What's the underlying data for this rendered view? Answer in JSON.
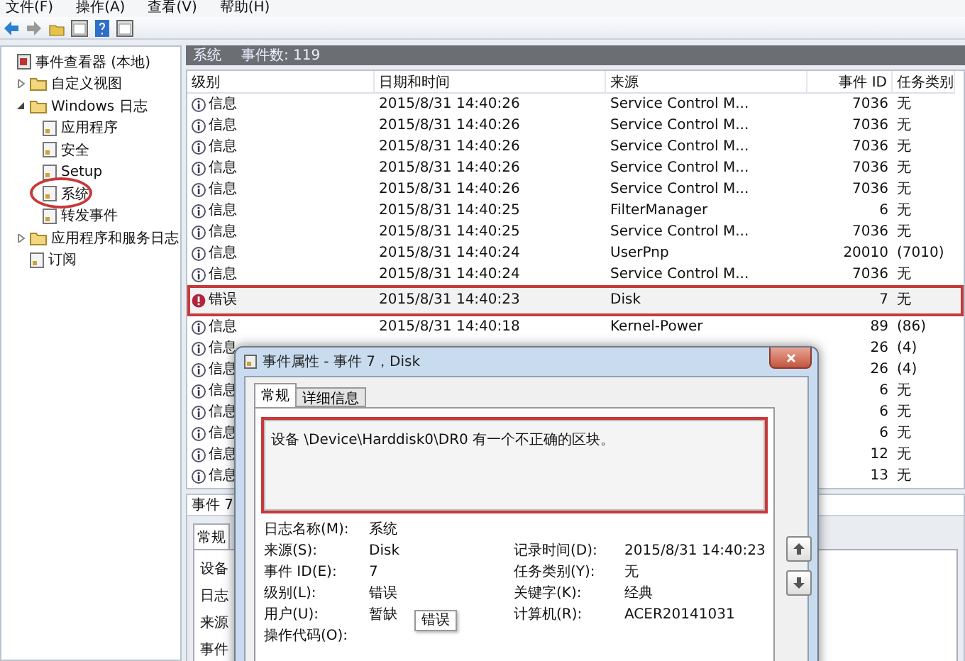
{
  "menu": [
    "文件(F)",
    "操作(A)",
    "查看(V)",
    "帮助(H)"
  ],
  "tree": [
    {
      "label": "事件查看器 (本地)",
      "kind": "root",
      "children": [
        {
          "label": "自定义视图",
          "kind": "folder",
          "expanded": false
        },
        {
          "label": "Windows 日志",
          "kind": "folder",
          "expanded": true,
          "children": [
            {
              "label": "应用程序",
              "kind": "log",
              "circled": false
            },
            {
              "label": "安全",
              "kind": "log",
              "circled": false
            },
            {
              "label": "Setup",
              "kind": "log",
              "circled": false
            },
            {
              "label": "系统",
              "kind": "log",
              "circled": true
            },
            {
              "label": "转发事件",
              "kind": "log",
              "circled": false
            }
          ]
        },
        {
          "label": "应用程序和服务日志",
          "kind": "folder",
          "expanded": false
        },
        {
          "label": "订阅",
          "kind": "log"
        }
      ]
    }
  ],
  "panel": {
    "title": "系统",
    "count": "事件数: 119"
  },
  "table": {
    "columns": [
      "级别",
      "日期和时间",
      "来源",
      "事件 ID",
      "任务类别"
    ],
    "rows": [
      {
        "kind": "info",
        "level": "信息",
        "date": "2015/8/31 14:40:26",
        "source": "Service Control M...",
        "id": "7036",
        "task": "无",
        "highlighted": false
      },
      {
        "kind": "info",
        "level": "信息",
        "date": "2015/8/31 14:40:26",
        "source": "Service Control M...",
        "id": "7036",
        "task": "无",
        "highlighted": false
      },
      {
        "kind": "info",
        "level": "信息",
        "date": "2015/8/31 14:40:26",
        "source": "Service Control M...",
        "id": "7036",
        "task": "无",
        "highlighted": false
      },
      {
        "kind": "info",
        "level": "信息",
        "date": "2015/8/31 14:40:26",
        "source": "Service Control M...",
        "id": "7036",
        "task": "无",
        "highlighted": false
      },
      {
        "kind": "info",
        "level": "信息",
        "date": "2015/8/31 14:40:26",
        "source": "Service Control M...",
        "id": "7036",
        "task": "无",
        "highlighted": false
      },
      {
        "kind": "info",
        "level": "信息",
        "date": "2015/8/31 14:40:25",
        "source": "FilterManager",
        "id": "6",
        "task": "无",
        "highlighted": false
      },
      {
        "kind": "info",
        "level": "信息",
        "date": "2015/8/31 14:40:25",
        "source": "Service Control M...",
        "id": "7036",
        "task": "无",
        "highlighted": false
      },
      {
        "kind": "info",
        "level": "信息",
        "date": "2015/8/31 14:40:24",
        "source": "UserPnp",
        "id": "20010",
        "task": "(7010)",
        "highlighted": false
      },
      {
        "kind": "info",
        "level": "信息",
        "date": "2015/8/31 14:40:24",
        "source": "Service Control M...",
        "id": "7036",
        "task": "无",
        "highlighted": false
      },
      {
        "kind": "error",
        "level": "错误",
        "date": "2015/8/31 14:40:23",
        "source": "Disk",
        "id": "7",
        "task": "无",
        "highlighted": true
      },
      {
        "kind": "info",
        "level": "信息",
        "date": "2015/8/31 14:40:18",
        "source": "Kernel-Power",
        "id": "89",
        "task": "(86)",
        "highlighted": false
      },
      {
        "kind": "info",
        "level": "信息",
        "id": "26",
        "task": "(4)",
        "highlighted": false
      },
      {
        "kind": "info",
        "level": "信息",
        "id": "26",
        "task": "(4)",
        "highlighted": false
      },
      {
        "kind": "info",
        "level": "信息",
        "id": "6",
        "task": "无",
        "highlighted": false
      },
      {
        "kind": "info",
        "level": "信息",
        "id": "6",
        "task": "无",
        "highlighted": false
      },
      {
        "kind": "info",
        "level": "信息",
        "id": "6",
        "task": "无",
        "highlighted": false
      },
      {
        "kind": "info",
        "level": "信息",
        "id": "12",
        "task": "无",
        "highlighted": false
      },
      {
        "kind": "info",
        "level": "信息",
        "id": "13",
        "task": "无",
        "highlighted": false
      }
    ]
  },
  "preview": {
    "title": "事件 7",
    "tab": "常规",
    "lines": [
      "设备",
      "日志",
      "来源",
      "事件"
    ]
  },
  "dialog": {
    "title": "事件属性 - 事件 7，Disk",
    "tabs": [
      {
        "label": "常规",
        "selected": true
      },
      {
        "label": "详细信息",
        "selected": false
      }
    ],
    "message": "设备 \\Device\\Harddisk0\\DR0 有一个不正确的区块。",
    "message_highlighted": true,
    "fields": [
      [
        {
          "label": "日志名称(M):",
          "value": "系统"
        }
      ],
      [
        {
          "label": "来源(S):",
          "value": "Disk"
        },
        {
          "label": "记录时间(D):",
          "value": "2015/8/31 14:40:23"
        }
      ],
      [
        {
          "label": "事件 ID(E):",
          "value": "7"
        },
        {
          "label": "任务类别(Y):",
          "value": "无"
        }
      ],
      [
        {
          "label": "级别(L):",
          "value": "错误"
        },
        {
          "label": "关键字(K):",
          "value": "经典"
        }
      ],
      [
        {
          "label": "用户(U):",
          "value": "暂缺"
        },
        {
          "label": "计算机(R):",
          "value": "ACER20141031"
        }
      ],
      [
        {
          "label": "操作代码(O):"
        }
      ]
    ],
    "tooltip": "错误"
  }
}
